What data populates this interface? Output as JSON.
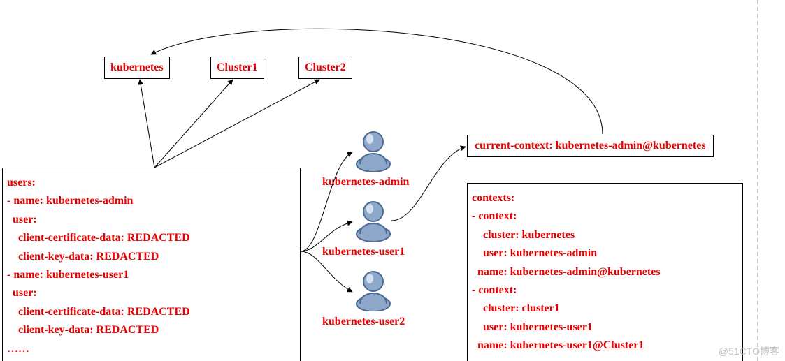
{
  "clusters": {
    "a": "kubernetes",
    "b": "Cluster1",
    "c": "Cluster2"
  },
  "users_box": "users:\n- name: kubernetes-admin\n  user:\n    client-certificate-data: REDACTED\n    client-key-data: REDACTED\n- name: kubernetes-user1\n  user:\n    client-certificate-data: REDACTED\n    client-key-data: REDACTED\n……",
  "person_labels": {
    "p1": "kubernetes-admin",
    "p2": "kubernetes-user1",
    "p3": "kubernetes-user2"
  },
  "current_context": "current-context:  kubernetes-admin@kubernetes",
  "contexts_box": "contexts:\n- context:\n    cluster: kubernetes\n    user: kubernetes-admin\n  name: kubernetes-admin@kubernetes\n- context:\n    cluster: cluster1\n    user: kubernetes-user1\n  name: kubernetes-user1@Cluster1",
  "watermark": "@51CTO博客",
  "colors": {
    "text_accent": "#e60000",
    "person_fill": "#8da8c9",
    "person_stroke": "#4b6b94"
  },
  "chart_data": {
    "type": "diagram",
    "nodes": [
      {
        "id": "kubernetes",
        "kind": "cluster",
        "label": "kubernetes"
      },
      {
        "id": "Cluster1",
        "kind": "cluster",
        "label": "Cluster1"
      },
      {
        "id": "Cluster2",
        "kind": "cluster",
        "label": "Cluster2"
      },
      {
        "id": "users",
        "kind": "yaml-block",
        "label": "users: ..."
      },
      {
        "id": "kubernetes-admin",
        "kind": "user",
        "label": "kubernetes-admin"
      },
      {
        "id": "kubernetes-user1",
        "kind": "user",
        "label": "kubernetes-user1"
      },
      {
        "id": "kubernetes-user2",
        "kind": "user",
        "label": "kubernetes-user2"
      },
      {
        "id": "current-context",
        "kind": "yaml-line",
        "label": "current-context: kubernetes-admin@kubernetes"
      },
      {
        "id": "contexts",
        "kind": "yaml-block",
        "label": "contexts: ..."
      }
    ],
    "edges": [
      {
        "from": "users",
        "to": "kubernetes"
      },
      {
        "from": "users",
        "to": "Cluster1"
      },
      {
        "from": "users",
        "to": "Cluster2"
      },
      {
        "from": "users",
        "to": "kubernetes-admin"
      },
      {
        "from": "users",
        "to": "kubernetes-user1"
      },
      {
        "from": "users",
        "to": "kubernetes-user2"
      },
      {
        "from": "kubernetes-user1",
        "to": "current-context"
      },
      {
        "from": "current-context",
        "to": "kubernetes",
        "style": "curved"
      }
    ]
  }
}
